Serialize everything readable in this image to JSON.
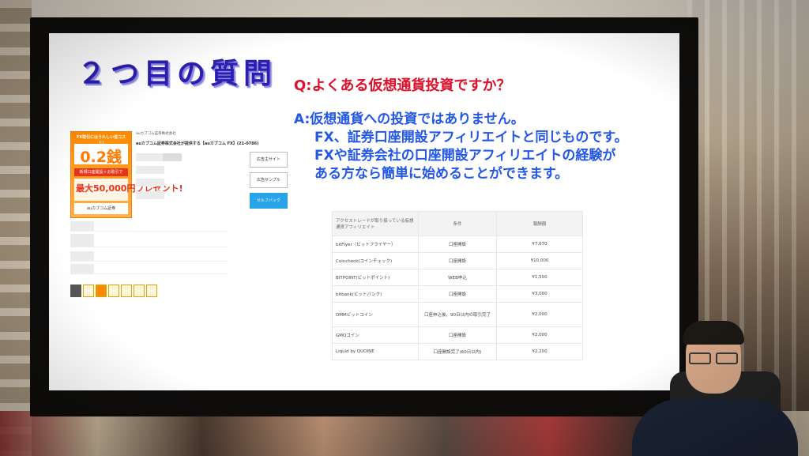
{
  "slide": {
    "title": "２つ目の質問",
    "question": "Q:よくある仮想通貨投資ですか？",
    "answer_lines": [
      "A:仮想通貨への投資ではありません。",
      "FX、証券口座開設アフィリエイトと同じものです。",
      "FXや証券会社の口座開設アフィリエイトの経験が",
      "ある方なら簡単に始めることができます。"
    ]
  },
  "mock": {
    "banner_top": "FX取引にはうれしい低コスト!",
    "banner_num": "0.2銭",
    "banner_new": "新規口座開設＋お取引で",
    "banner_big": "最大50,000円プレゼント!",
    "banner_brand": "auカブコム証券",
    "company": "auカブコム証券株式会社",
    "program": "auカブコム証券株式会社が提供する【auカブコム FX】(21-0786)",
    "btn_ad_site": "広告主サイト",
    "btn_ad_sample": "広告サンプル",
    "btn_self": "セルフバック"
  },
  "table": {
    "headers": [
      "アクセストレードが取り扱っている仮想通貨アフィリエイト",
      "条件",
      "報酬額"
    ],
    "rows": [
      [
        "bitFlyer（ビットフライヤー）",
        "口座開設",
        "¥7,670"
      ],
      [
        "Coincheck(コインチェック)",
        "口座開設",
        "¥10,000"
      ],
      [
        "BITPOINT(ビットポイント)",
        "WEB申込",
        "¥1,500"
      ],
      [
        "bitbank(ビットバンク)",
        "口座開設",
        "¥3,000"
      ],
      [
        "DMMビットコイン",
        "口座申込後、90日以内の取引完了",
        "¥2,000"
      ],
      [
        "GMOコイン",
        "口座開設",
        "¥2,000"
      ],
      [
        "Liquid by QUOINE",
        "口座開設完了(60日以内)",
        "¥2,200"
      ]
    ]
  }
}
